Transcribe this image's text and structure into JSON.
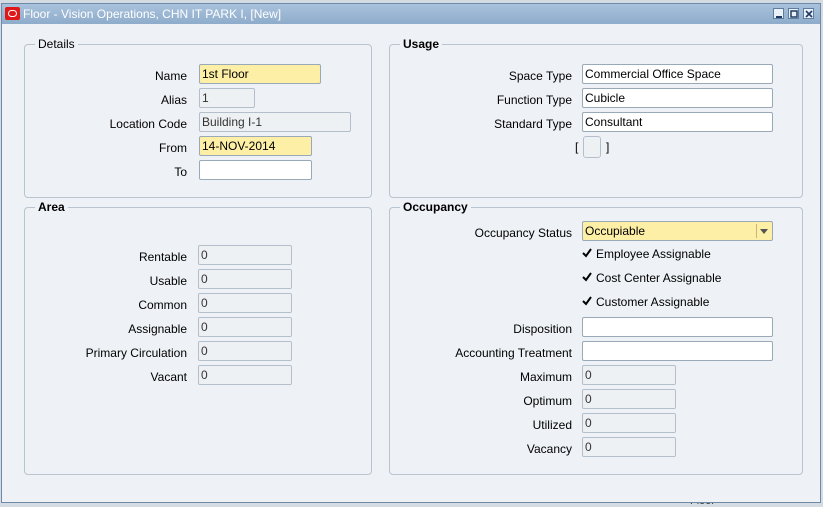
{
  "window": {
    "title": "Floor - Vision Operations, CHN IT PARK I, [New]"
  },
  "background_text": "Floor",
  "details": {
    "title": "Details",
    "name_label": "Name",
    "name_value": "1st Floor",
    "alias_label": "Alias",
    "alias_value": "1",
    "location_code_label": "Location Code",
    "location_code_value": "Building I-1",
    "from_label": "From",
    "from_value": "14-NOV-2014",
    "to_label": "To",
    "to_value": ""
  },
  "usage": {
    "title": "Usage",
    "space_type_label": "Space Type",
    "space_type_value": "Commercial Office Space",
    "function_type_label": "Function Type",
    "function_type_value": "Cubicle",
    "standard_type_label": "Standard Type",
    "standard_type_value": "Consultant",
    "bracket_open": "[",
    "bracket_close": "]"
  },
  "area": {
    "title": "Area",
    "rentable_label": "Rentable",
    "rentable_value": "0",
    "usable_label": "Usable",
    "usable_value": "0",
    "common_label": "Common",
    "common_value": "0",
    "assignable_label": "Assignable",
    "assignable_value": "0",
    "primary_circulation_label": "Primary Circulation",
    "primary_circulation_value": "0",
    "vacant_label": "Vacant",
    "vacant_value": "0"
  },
  "occupancy": {
    "title": "Occupancy",
    "status_label": "Occupancy Status",
    "status_value": "Occupiable",
    "employee_assignable_label": "Employee Assignable",
    "employee_assignable_checked": true,
    "cost_center_assignable_label": "Cost Center Assignable",
    "cost_center_assignable_checked": true,
    "customer_assignable_label": "Customer Assignable",
    "customer_assignable_checked": true,
    "disposition_label": "Disposition",
    "disposition_value": "",
    "accounting_treatment_label": "Accounting Treatment",
    "accounting_treatment_value": "",
    "maximum_label": "Maximum",
    "maximum_value": "0",
    "optimum_label": "Optimum",
    "optimum_value": "0",
    "utilized_label": "Utilized",
    "utilized_value": "0",
    "vacancy_label": "Vacancy",
    "vacancy_value": "0"
  },
  "colors": {
    "required_field": "#fdefa6",
    "titlebar": "#8eaccb",
    "oracle_red": "#e01818"
  }
}
